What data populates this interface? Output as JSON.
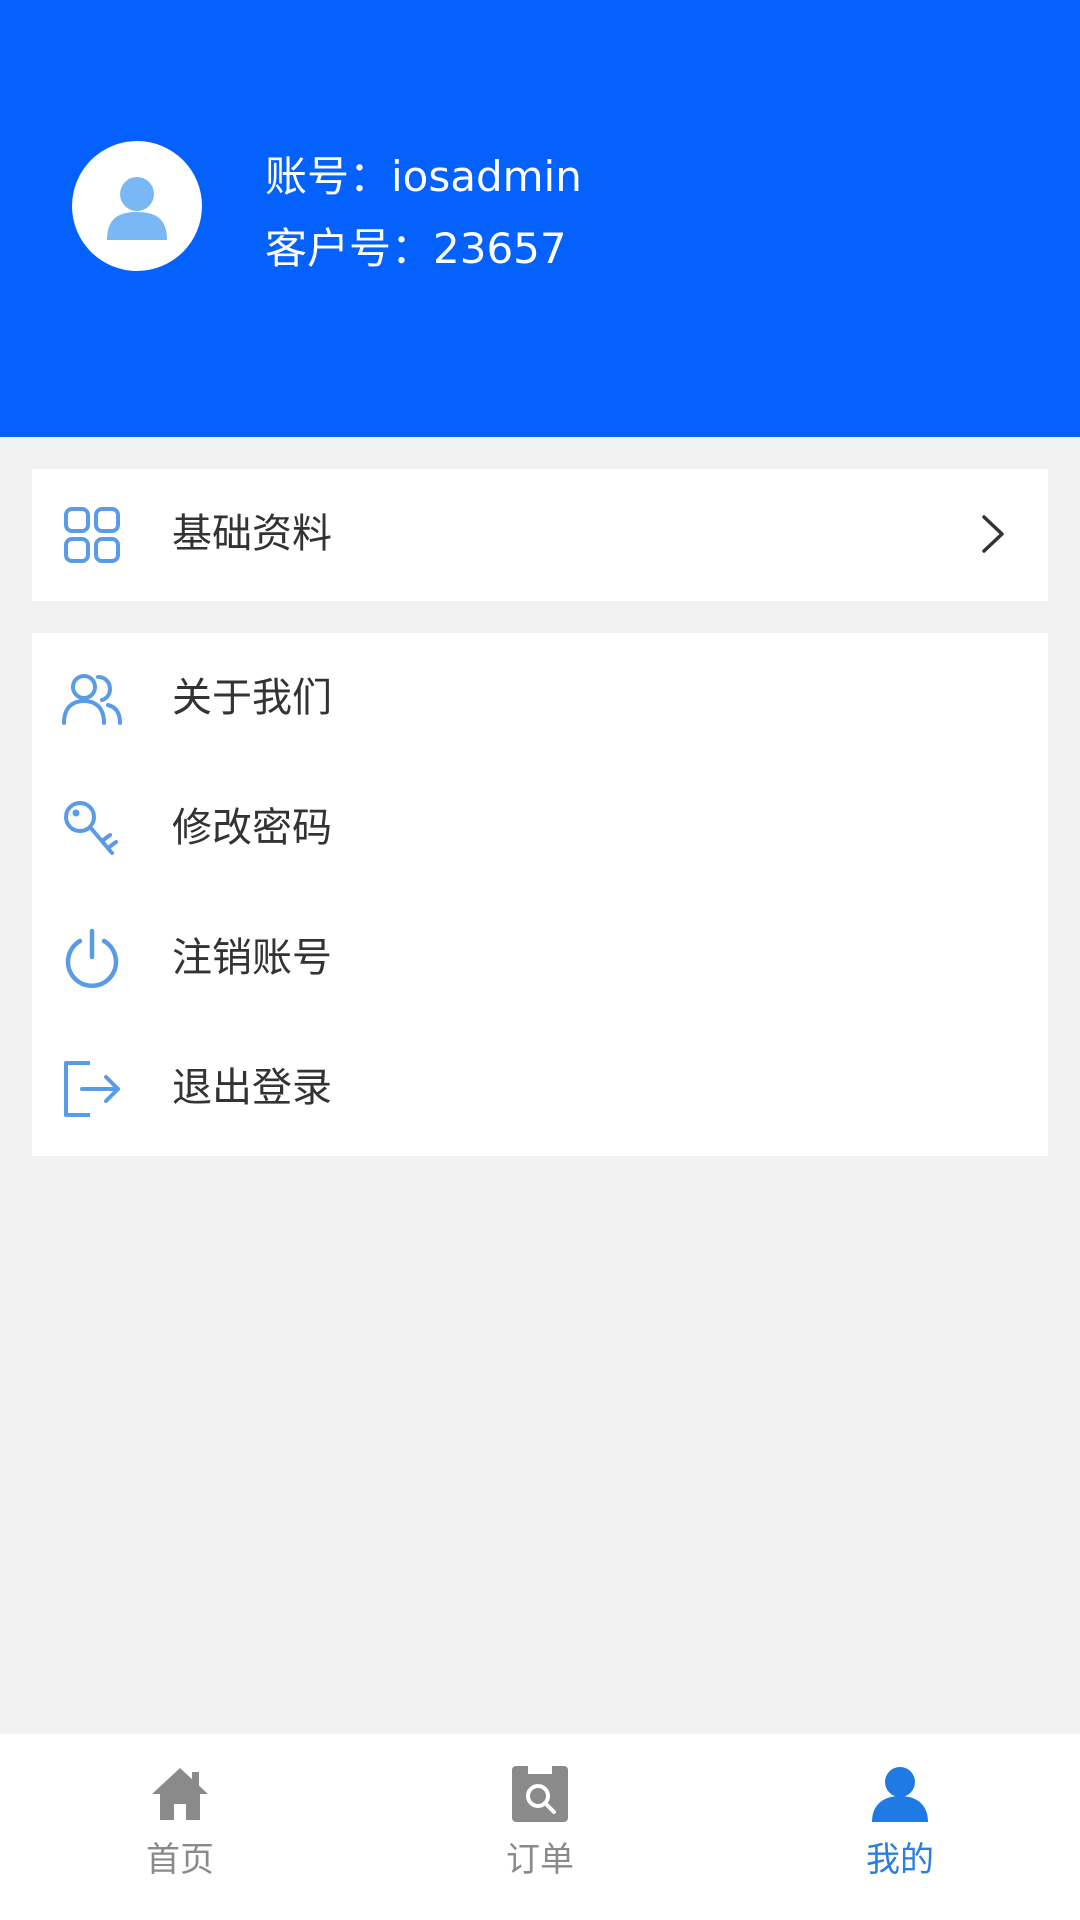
{
  "profile": {
    "account_line": "账号：iosadmin",
    "customer_line": "客户号：23657"
  },
  "menu_primary": [
    {
      "label": "基础资料",
      "icon": "grid-icon"
    }
  ],
  "menu_secondary": [
    {
      "label": "关于我们",
      "icon": "users-icon"
    },
    {
      "label": "修改密码",
      "icon": "key-icon"
    },
    {
      "label": "注销账号",
      "icon": "power-icon"
    },
    {
      "label": "退出登录",
      "icon": "logout-icon"
    }
  ],
  "tabbar": {
    "tabs": [
      {
        "label": "首页",
        "icon": "home-icon"
      },
      {
        "label": "订单",
        "icon": "order-icon"
      },
      {
        "label": "我的",
        "icon": "user-icon"
      }
    ],
    "active_index": 2
  },
  "colors": {
    "header_bg": "#0461fe",
    "icon_blue": "#5a9be8",
    "active_tab": "#2a7de1",
    "inactive_tab": "#8a8a8a"
  }
}
